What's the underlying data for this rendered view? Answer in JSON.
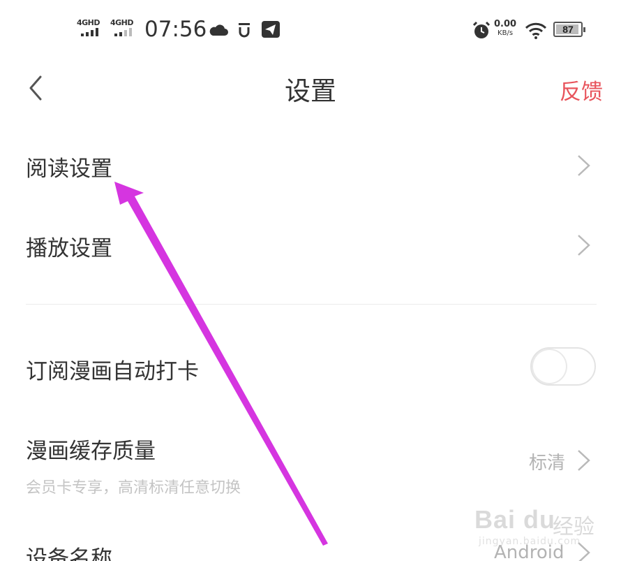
{
  "status_bar": {
    "sim1_network": "4GHD",
    "sim2_network": "4GHD",
    "time": "07:56",
    "net_speed_value": "0.00",
    "net_speed_unit": "KB/s",
    "battery_level": "87",
    "icons": [
      "cloud-icon",
      "vpn-icon",
      "telegram-icon",
      "alarm-icon",
      "wifi-icon",
      "battery-icon"
    ]
  },
  "header": {
    "back_icon": "chevron-left-icon",
    "title": "设置",
    "feedback_label": "反馈",
    "feedback_color": "#e8545c"
  },
  "settings": {
    "reading": {
      "label": "阅读设置"
    },
    "playback": {
      "label": "播放设置"
    },
    "subscribe_checkin": {
      "label": "订阅漫画自动打卡",
      "enabled": false
    },
    "cache_quality": {
      "label": "漫画缓存质量",
      "value": "标清",
      "sub": "会员卡专享，高清标清任意切换"
    },
    "device_name": {
      "label": "设备名称",
      "value": "Android"
    }
  },
  "annotation": {
    "arrow_color": "#d535e0"
  },
  "watermark": {
    "brand": "Bai du",
    "cn": "经验",
    "url": "jingyan.baidu.com"
  }
}
